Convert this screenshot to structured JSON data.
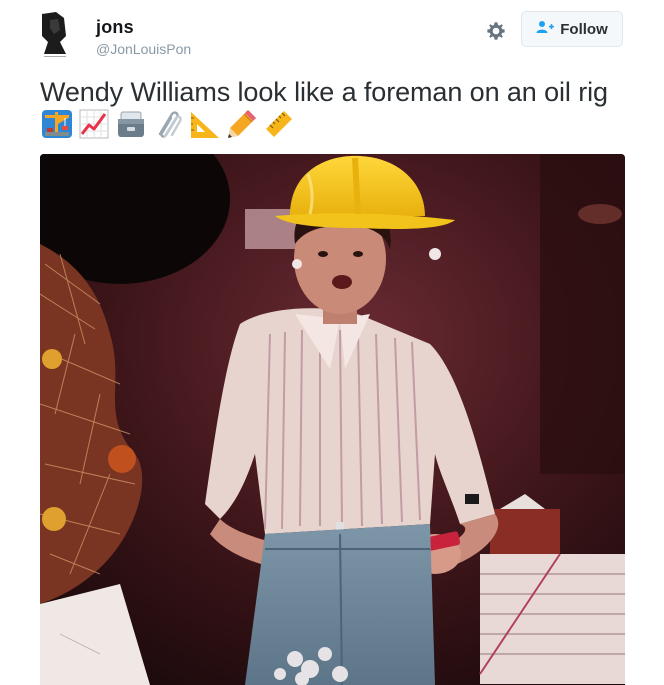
{
  "author": {
    "display_name": "jons",
    "handle": "@JonLouisPon"
  },
  "actions": {
    "follow_label": "Follow",
    "settings_icon": "gear-icon",
    "follow_icon": "add-user-icon"
  },
  "tweet": {
    "text": "Wendy Williams look like a foreman on an oil rig",
    "emojis": [
      "construction-crane",
      "chart-increasing",
      "card-file-box",
      "paperclips",
      "triangular-ruler",
      "pencil",
      "straight-ruler"
    ]
  },
  "photo": {
    "subject": "vintage photo of a person in a yellow hard hat and striped shirt"
  },
  "colors": {
    "text": "#292f33",
    "muted": "#8899a6",
    "follow_bg": "#f5f8fa",
    "follow_border": "#e1e8ed",
    "accent": "#1da1f2",
    "hardhat": "#f2c41b"
  }
}
